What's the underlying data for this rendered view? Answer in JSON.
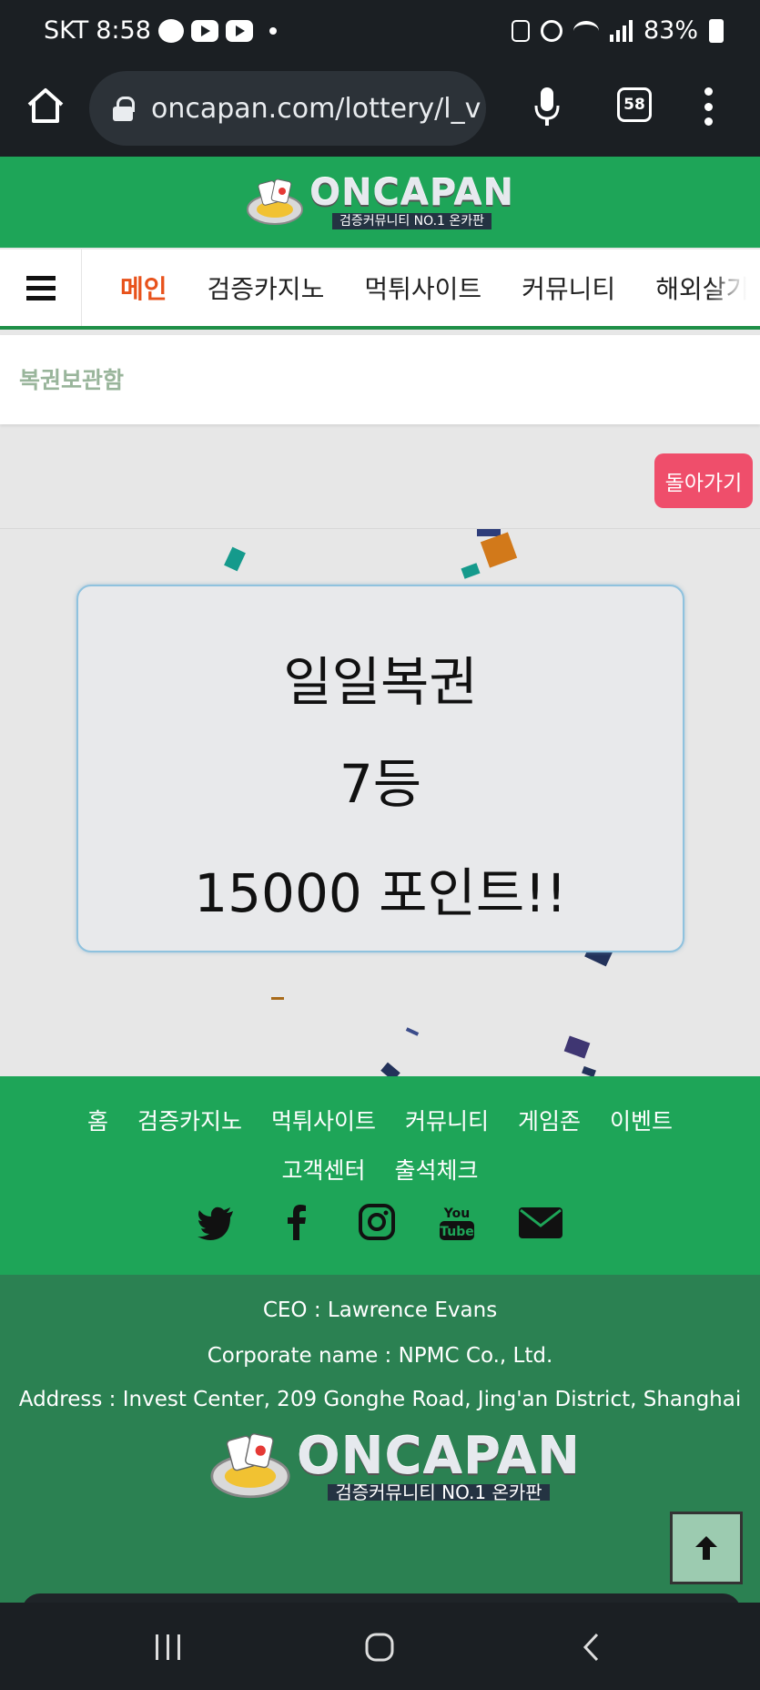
{
  "status_bar": {
    "carrier": "SKT",
    "time": "8:58",
    "battery": "83%"
  },
  "browser": {
    "url": "oncapan.com/lottery/l_v",
    "tab_count": "58"
  },
  "site": {
    "logo_text": "ONCAPAN",
    "logo_tagline": "검증커뮤니티 NO.1 온카판",
    "nav": {
      "items": [
        "메인",
        "검증카지노",
        "먹튀사이트",
        "커뮤니티",
        "해외살기"
      ]
    },
    "breadcrumb": "복권보관함",
    "back_button": "돌아가기"
  },
  "result": {
    "line1": "일일복권",
    "line2": "7등",
    "line3": "15000 포인트!!"
  },
  "footer": {
    "links_row1": [
      "홈",
      "검증카지노",
      "먹튀사이트",
      "커뮤니티",
      "게임존",
      "이벤트"
    ],
    "links_row2": [
      "고객센터",
      "출석체크"
    ],
    "social": [
      "twitter-icon",
      "facebook-icon",
      "instagram-icon",
      "youtube-icon",
      "email-icon"
    ],
    "ceo": "CEO : Lawrence Evans",
    "corporate": "Corporate name : NPMC Co., Ltd.",
    "address": "Address : Invest Center, 209 Gonghe Road, Jing'an District, Shanghai"
  },
  "colors": {
    "brand_green": "#1ea558",
    "footer_green": "#2b8152",
    "accent_orange": "#e8521b",
    "back_button": "#ef4e6b"
  }
}
